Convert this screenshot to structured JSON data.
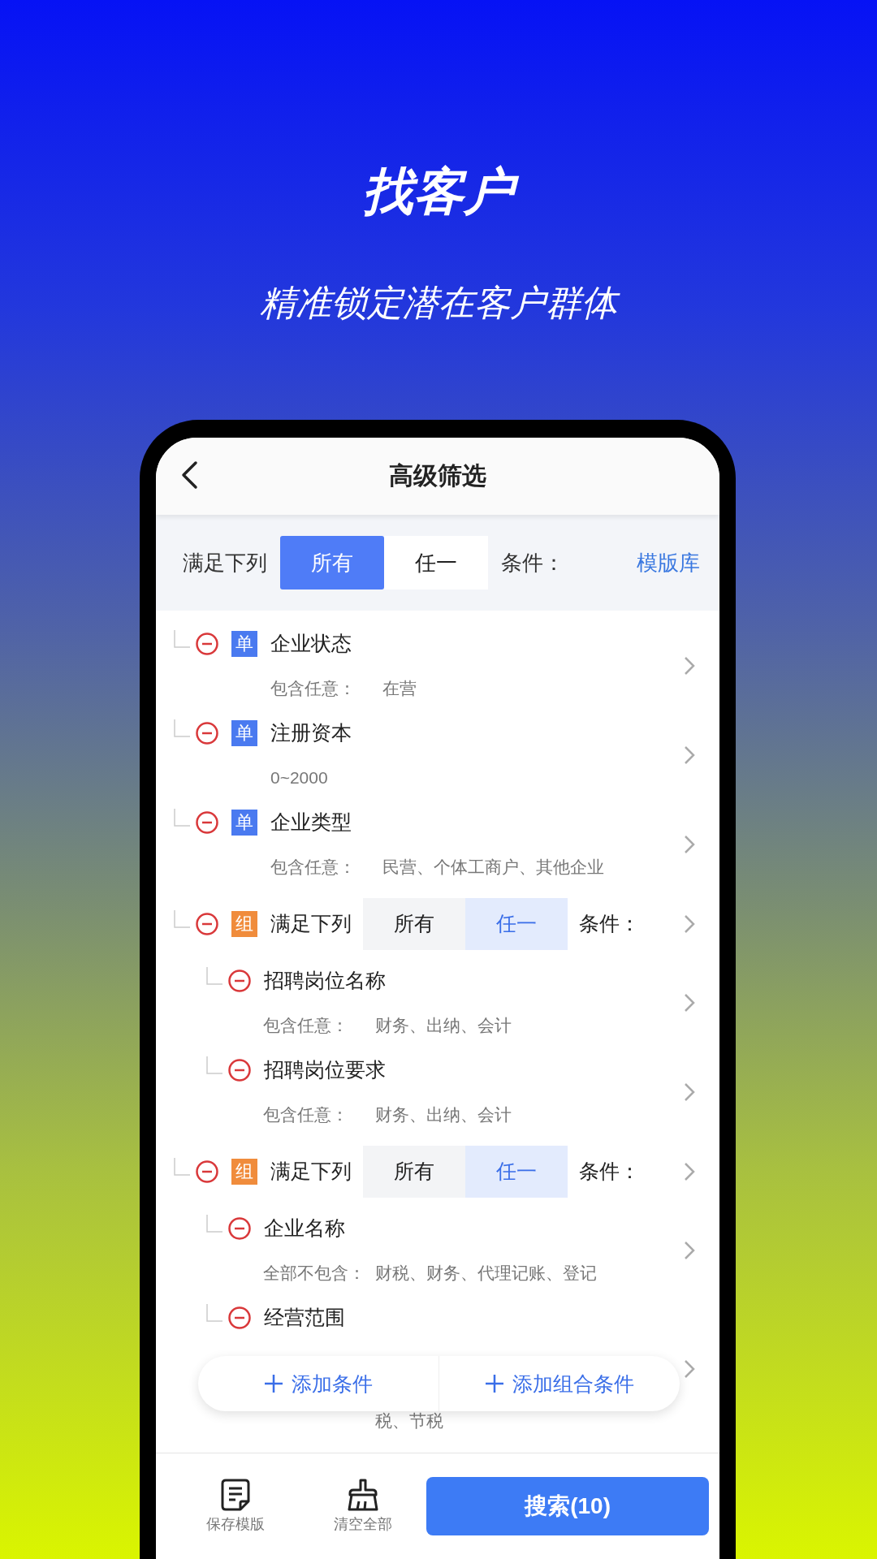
{
  "hero": {
    "title": "找客户",
    "subtitle": "精准锁定潜在客户群体"
  },
  "screen": {
    "title": "高级筛选",
    "match_bar": {
      "prefix": "满足下列",
      "options": [
        {
          "label": "所有",
          "selected": true
        },
        {
          "label": "任一",
          "selected": false
        }
      ],
      "suffix": "条件：",
      "template_link": "模版库"
    },
    "conditions": [
      {
        "kind": "single",
        "badge": "单",
        "name": "企业状态",
        "operator": "包含任意：",
        "value": "在营"
      },
      {
        "kind": "single",
        "badge": "单",
        "name": "注册资本",
        "value": "0~2000"
      },
      {
        "kind": "single",
        "badge": "单",
        "name": "企业类型",
        "operator": "包含任意：",
        "value": "民营、个体工商户、其他企业"
      },
      {
        "kind": "group",
        "badge": "组",
        "prefix": "满足下列",
        "options": [
          {
            "label": "所有",
            "selected": false
          },
          {
            "label": "任一",
            "selected": true
          }
        ],
        "suffix": "条件：",
        "children": [
          {
            "name": "招聘岗位名称",
            "operator": "包含任意：",
            "value": "财务、出纳、会计"
          },
          {
            "name": "招聘岗位要求",
            "operator": "包含任意：",
            "value": "财务、出纳、会计"
          }
        ]
      },
      {
        "kind": "group",
        "badge": "组",
        "prefix": "满足下列",
        "options": [
          {
            "label": "所有",
            "selected": false
          },
          {
            "label": "任一",
            "selected": true
          }
        ],
        "suffix": "条件：",
        "children": [
          {
            "name": "企业名称",
            "operator": "全部不包含：",
            "value": "财税、财务、代理记账、登记"
          },
          {
            "name": "经营范围",
            "value_continued": "税、节税"
          }
        ]
      }
    ],
    "add_buttons": [
      "添加条件",
      "添加组合条件"
    ],
    "bottom_actions": [
      {
        "kind": "save",
        "label": "保存模版"
      },
      {
        "kind": "clear",
        "label": "清空全部"
      }
    ],
    "search_button": "搜索(10)"
  }
}
